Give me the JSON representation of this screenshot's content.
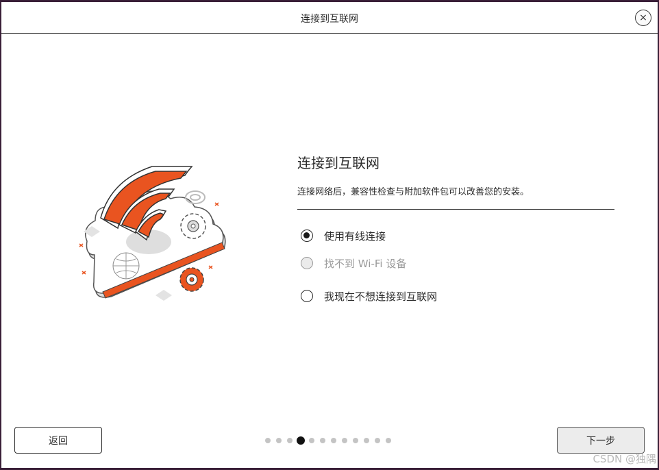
{
  "window": {
    "title": "连接到互联网",
    "close_icon": "×"
  },
  "content": {
    "heading": "连接到互联网",
    "subtitle": "连接网络后，兼容性检查与附加软件包可以改善您的安装。",
    "options": [
      {
        "label": "使用有线连接",
        "state": "checked"
      },
      {
        "label": "找不到 Wi-Fi 设备",
        "state": "disabled"
      },
      {
        "label": "我现在不想连接到互联网",
        "state": "unchecked"
      }
    ]
  },
  "footer": {
    "back_label": "返回",
    "next_label": "下一步",
    "step_total": 12,
    "step_current": 4
  },
  "watermark": "CSDN @独隅",
  "colors": {
    "accent": "#e95420",
    "window_bg": "#ffffff",
    "frame": "#3a1f38"
  }
}
